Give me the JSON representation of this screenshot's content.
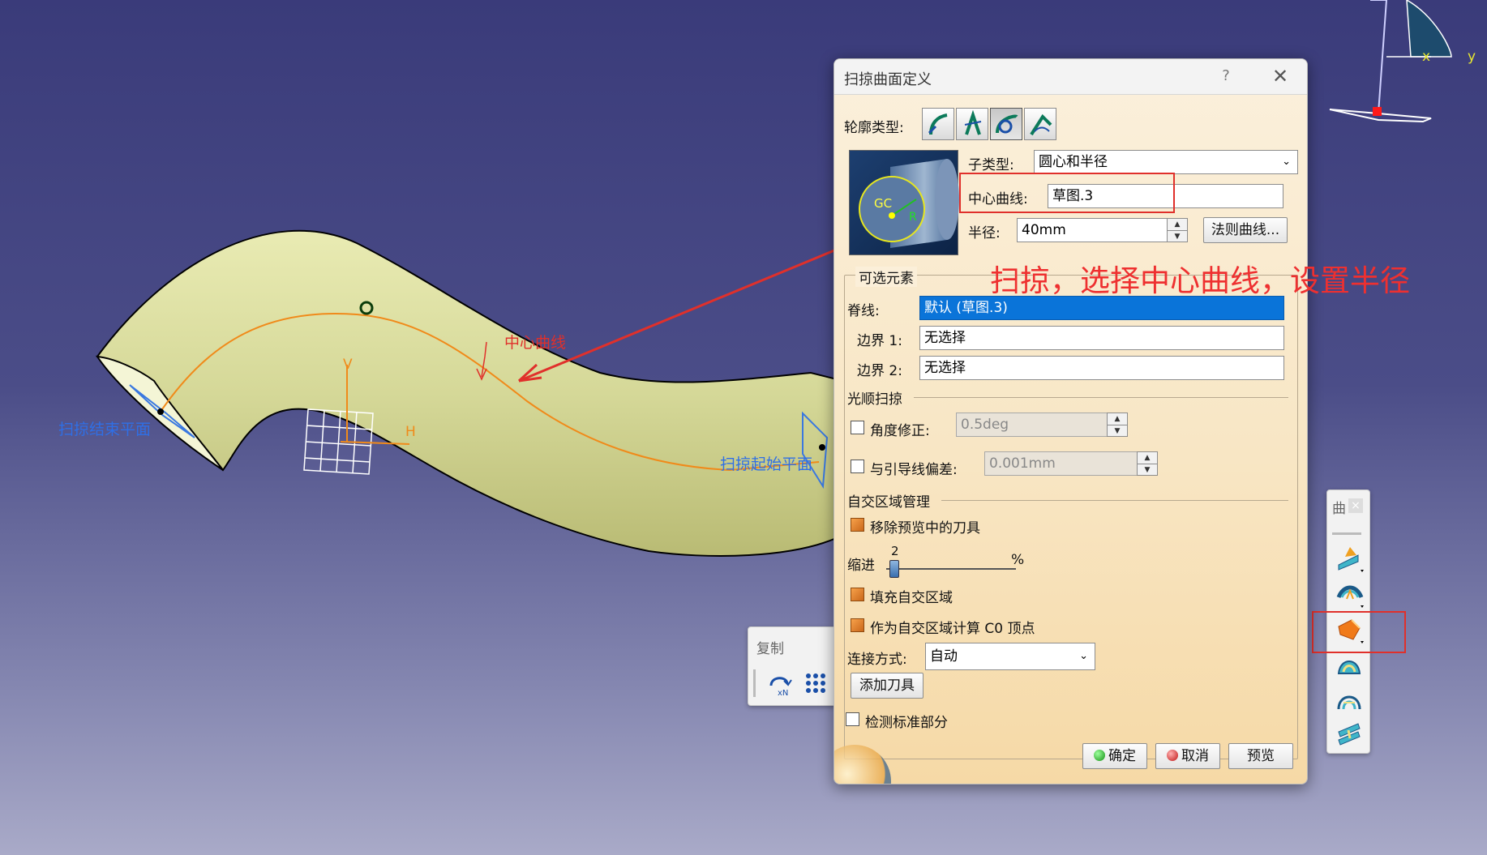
{
  "viewport": {
    "label_center_curve": "中心曲线",
    "label_sweep_end": "扫掠结束平面",
    "label_sweep_start": "扫掠起始平面",
    "axis_v": "V",
    "axis_h": "H",
    "compass_x": "x",
    "compass_y": "y",
    "gc_label": "GC",
    "r_label": "R"
  },
  "dialog": {
    "title": "扫掠曲面定义",
    "help": "?",
    "close": "✕",
    "profile_type_label": "轮廓类型:",
    "profile_types": [
      "line-profile-icon",
      "circle-profile-icon",
      "circle-center-radius-icon",
      "conic-profile-icon"
    ],
    "subtype_label": "子类型:",
    "subtype_value": "圆心和半径",
    "center_curve_label": "中心曲线:",
    "center_curve_value": "草图.3",
    "radius_label": "半径:",
    "radius_value": "40mm",
    "law_curve_button": "法则曲线...",
    "optional_elements_title": "可选元素",
    "spine_label": "脊线:",
    "spine_value": "默认 (草图.3)",
    "boundary1_label": "边界 1:",
    "boundary1_value": "无选择",
    "boundary2_label": "边界 2:",
    "boundary2_value": "无选择",
    "smooth_sweep_title": "光顺扫掠",
    "angle_correction_label": "角度修正:",
    "angle_correction_value": "0.5deg",
    "deviation_label": "与引导线偏差:",
    "deviation_value": "0.001mm",
    "self_intersection_title": "自交区域管理",
    "remove_tools_label": "移除预览中的刀具",
    "indent_label": "缩进",
    "indent_value": "2",
    "indent_unit": "%",
    "fill_label": "填充自交区域",
    "c0_label": "作为自交区域计算 C0 顶点",
    "connect_label": "连接方式:",
    "connect_value": "自动",
    "add_tool_button": "添加刀具",
    "detect_canonical_label": "检测标准部分",
    "ok_button": "确定",
    "cancel_button": "取消",
    "preview_button": "预览"
  },
  "copy_toolbar": {
    "title": "复制"
  },
  "right_toolbar": {
    "title": "曲",
    "close": "×"
  },
  "annotation": {
    "text": "扫掠，选择中心曲线，设置半径"
  },
  "colors": {
    "accent_red": "#e0302b",
    "selection_blue": "#0a74d9",
    "tube_fill": "#d9dc9a",
    "center_curve": "#f08a1a"
  }
}
